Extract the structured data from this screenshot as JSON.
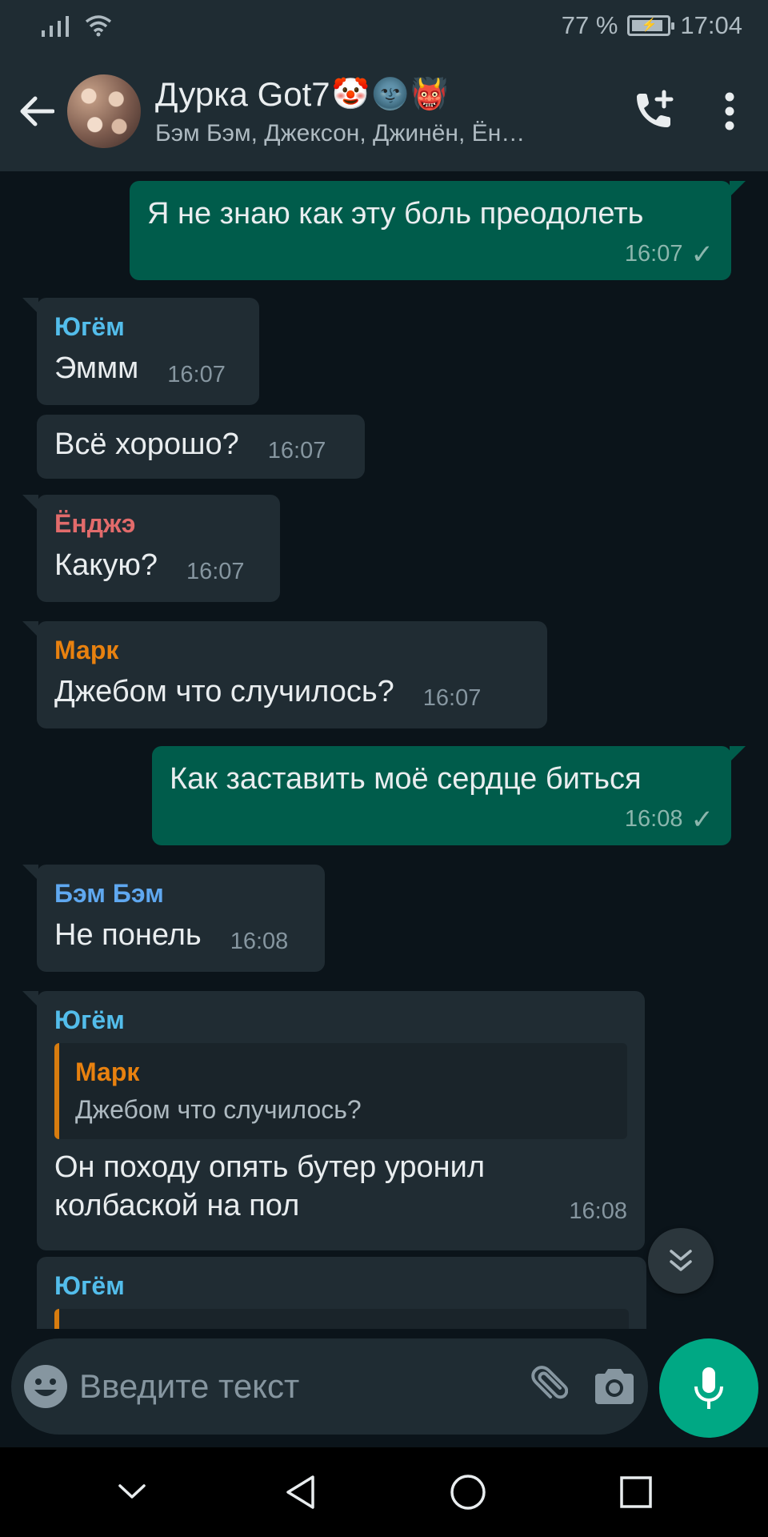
{
  "status_bar": {
    "battery_percent": "77 %",
    "time": "17:04"
  },
  "header": {
    "title": "Дурка Got7",
    "title_emojis": [
      "🤡",
      "🌚",
      "👹"
    ],
    "members": "Бэм Бэм, Джексон, Джинён, Ён…"
  },
  "messages": [
    {
      "type": "out",
      "text": "Я не знаю как эту боль преодолеть",
      "time": "16:07",
      "status": "✓"
    },
    {
      "type": "in",
      "sender": "Югём",
      "sender_color": "#53bdeb",
      "text": "Эммм",
      "time": "16:07"
    },
    {
      "type": "in",
      "text": "Всё хорошо?",
      "time": "16:07"
    },
    {
      "type": "in",
      "sender": "Ёнджэ",
      "sender_color": "#e26b6b",
      "text": "Какую?",
      "time": "16:07"
    },
    {
      "type": "in",
      "sender": "Марк",
      "sender_color": "#e8810f",
      "text": "Джебом что случилось?",
      "time": "16:07"
    },
    {
      "type": "out",
      "text": "Как заставить моё сердце биться",
      "time": "16:08",
      "status": "✓"
    },
    {
      "type": "in",
      "sender": "Бэм Бэм",
      "sender_color": "#5fa8f0",
      "text": "Не понель",
      "time": "16:08"
    },
    {
      "type": "in",
      "sender": "Югём",
      "sender_color": "#53bdeb",
      "quote": {
        "sender": "Марк",
        "sender_color": "#e8810f",
        "text": "Джебом что случилось?"
      },
      "text_line1": "Он походу опять бутер уронил",
      "text_line2": "колбаской на пол",
      "time": "16:08"
    },
    {
      "type": "in",
      "sender": "Югём",
      "sender_color": "#53bdeb"
    }
  ],
  "composer": {
    "placeholder": "Введите текст"
  },
  "colors": {
    "background": "#0b141a",
    "header": "#1f2c33",
    "incoming_bubble": "#202c33",
    "outgoing_bubble": "#005c4b",
    "accent": "#00a884"
  },
  "icons": {
    "back": "arrow-left-icon",
    "add_call": "phone-plus-icon",
    "menu": "more-vertical-icon",
    "emoji": "smiley-icon",
    "attach": "paperclip-icon",
    "camera": "camera-icon",
    "mic": "microphone-icon",
    "scroll_down": "double-chevron-down-icon"
  }
}
